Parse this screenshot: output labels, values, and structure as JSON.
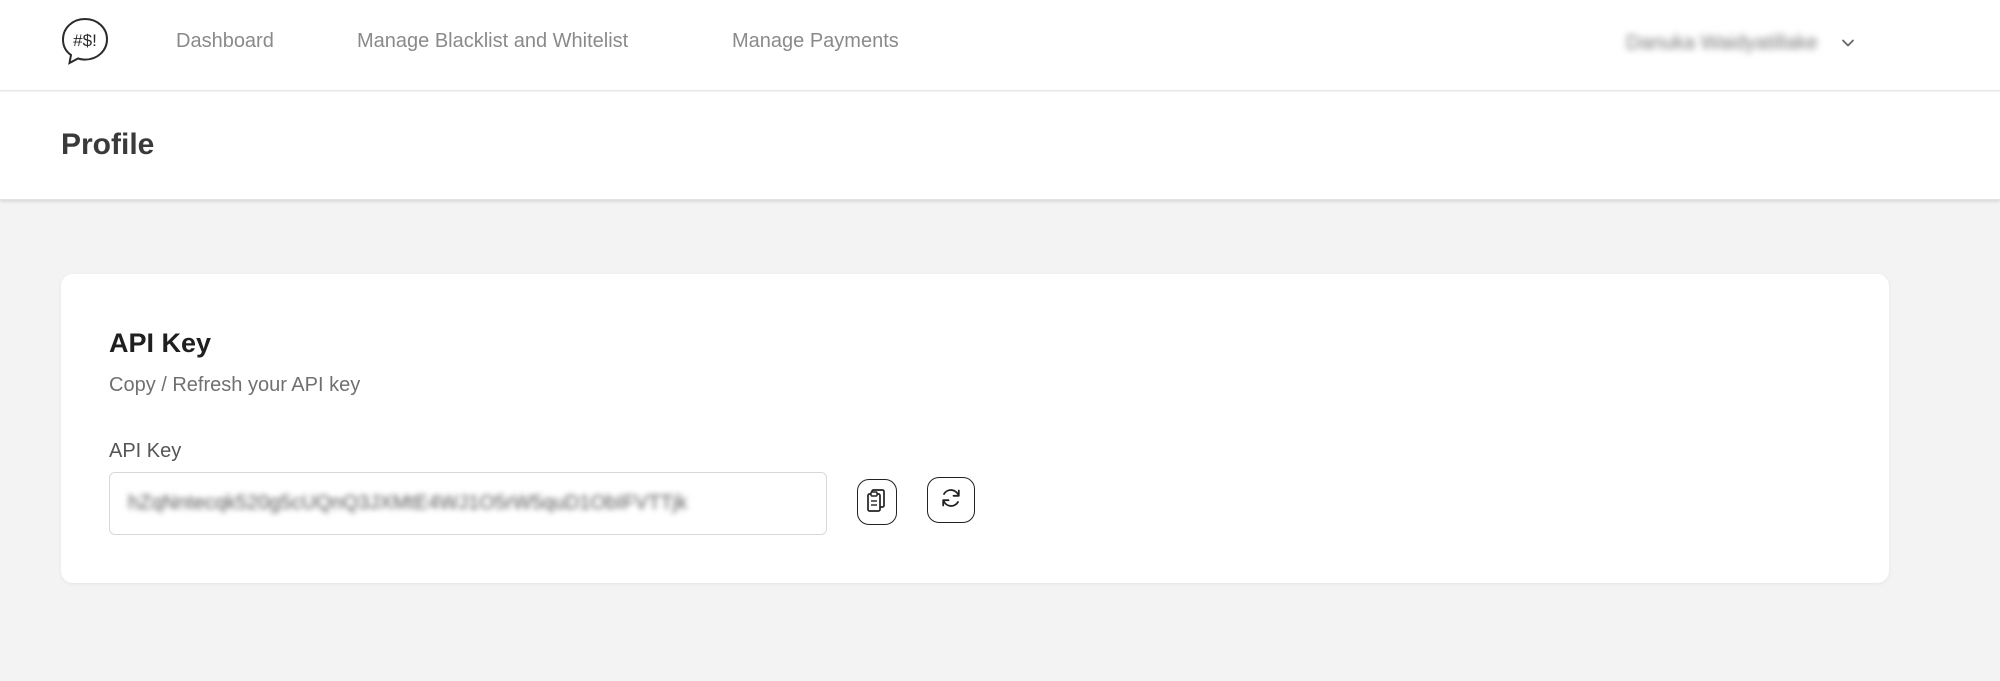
{
  "nav": {
    "logo_text": "#$!",
    "links": [
      "Dashboard",
      "Manage Blacklist and Whitelist",
      "Manage Payments"
    ],
    "user_name": "Danuka Waidyatillake"
  },
  "header": {
    "title": "Profile"
  },
  "api_card": {
    "title": "API Key",
    "subtitle": "Copy / Refresh your API key",
    "field_label": "API Key",
    "field_value": "hZqNntecqk520g5cUQnQ3JXMtE4WJ1O5rW5quD1ObIFVTTjk"
  },
  "icons": {
    "logo": "chat-bubble-logo-icon",
    "user_menu": "chevron-down-icon",
    "copy": "copy-icon",
    "refresh": "refresh-icon"
  }
}
